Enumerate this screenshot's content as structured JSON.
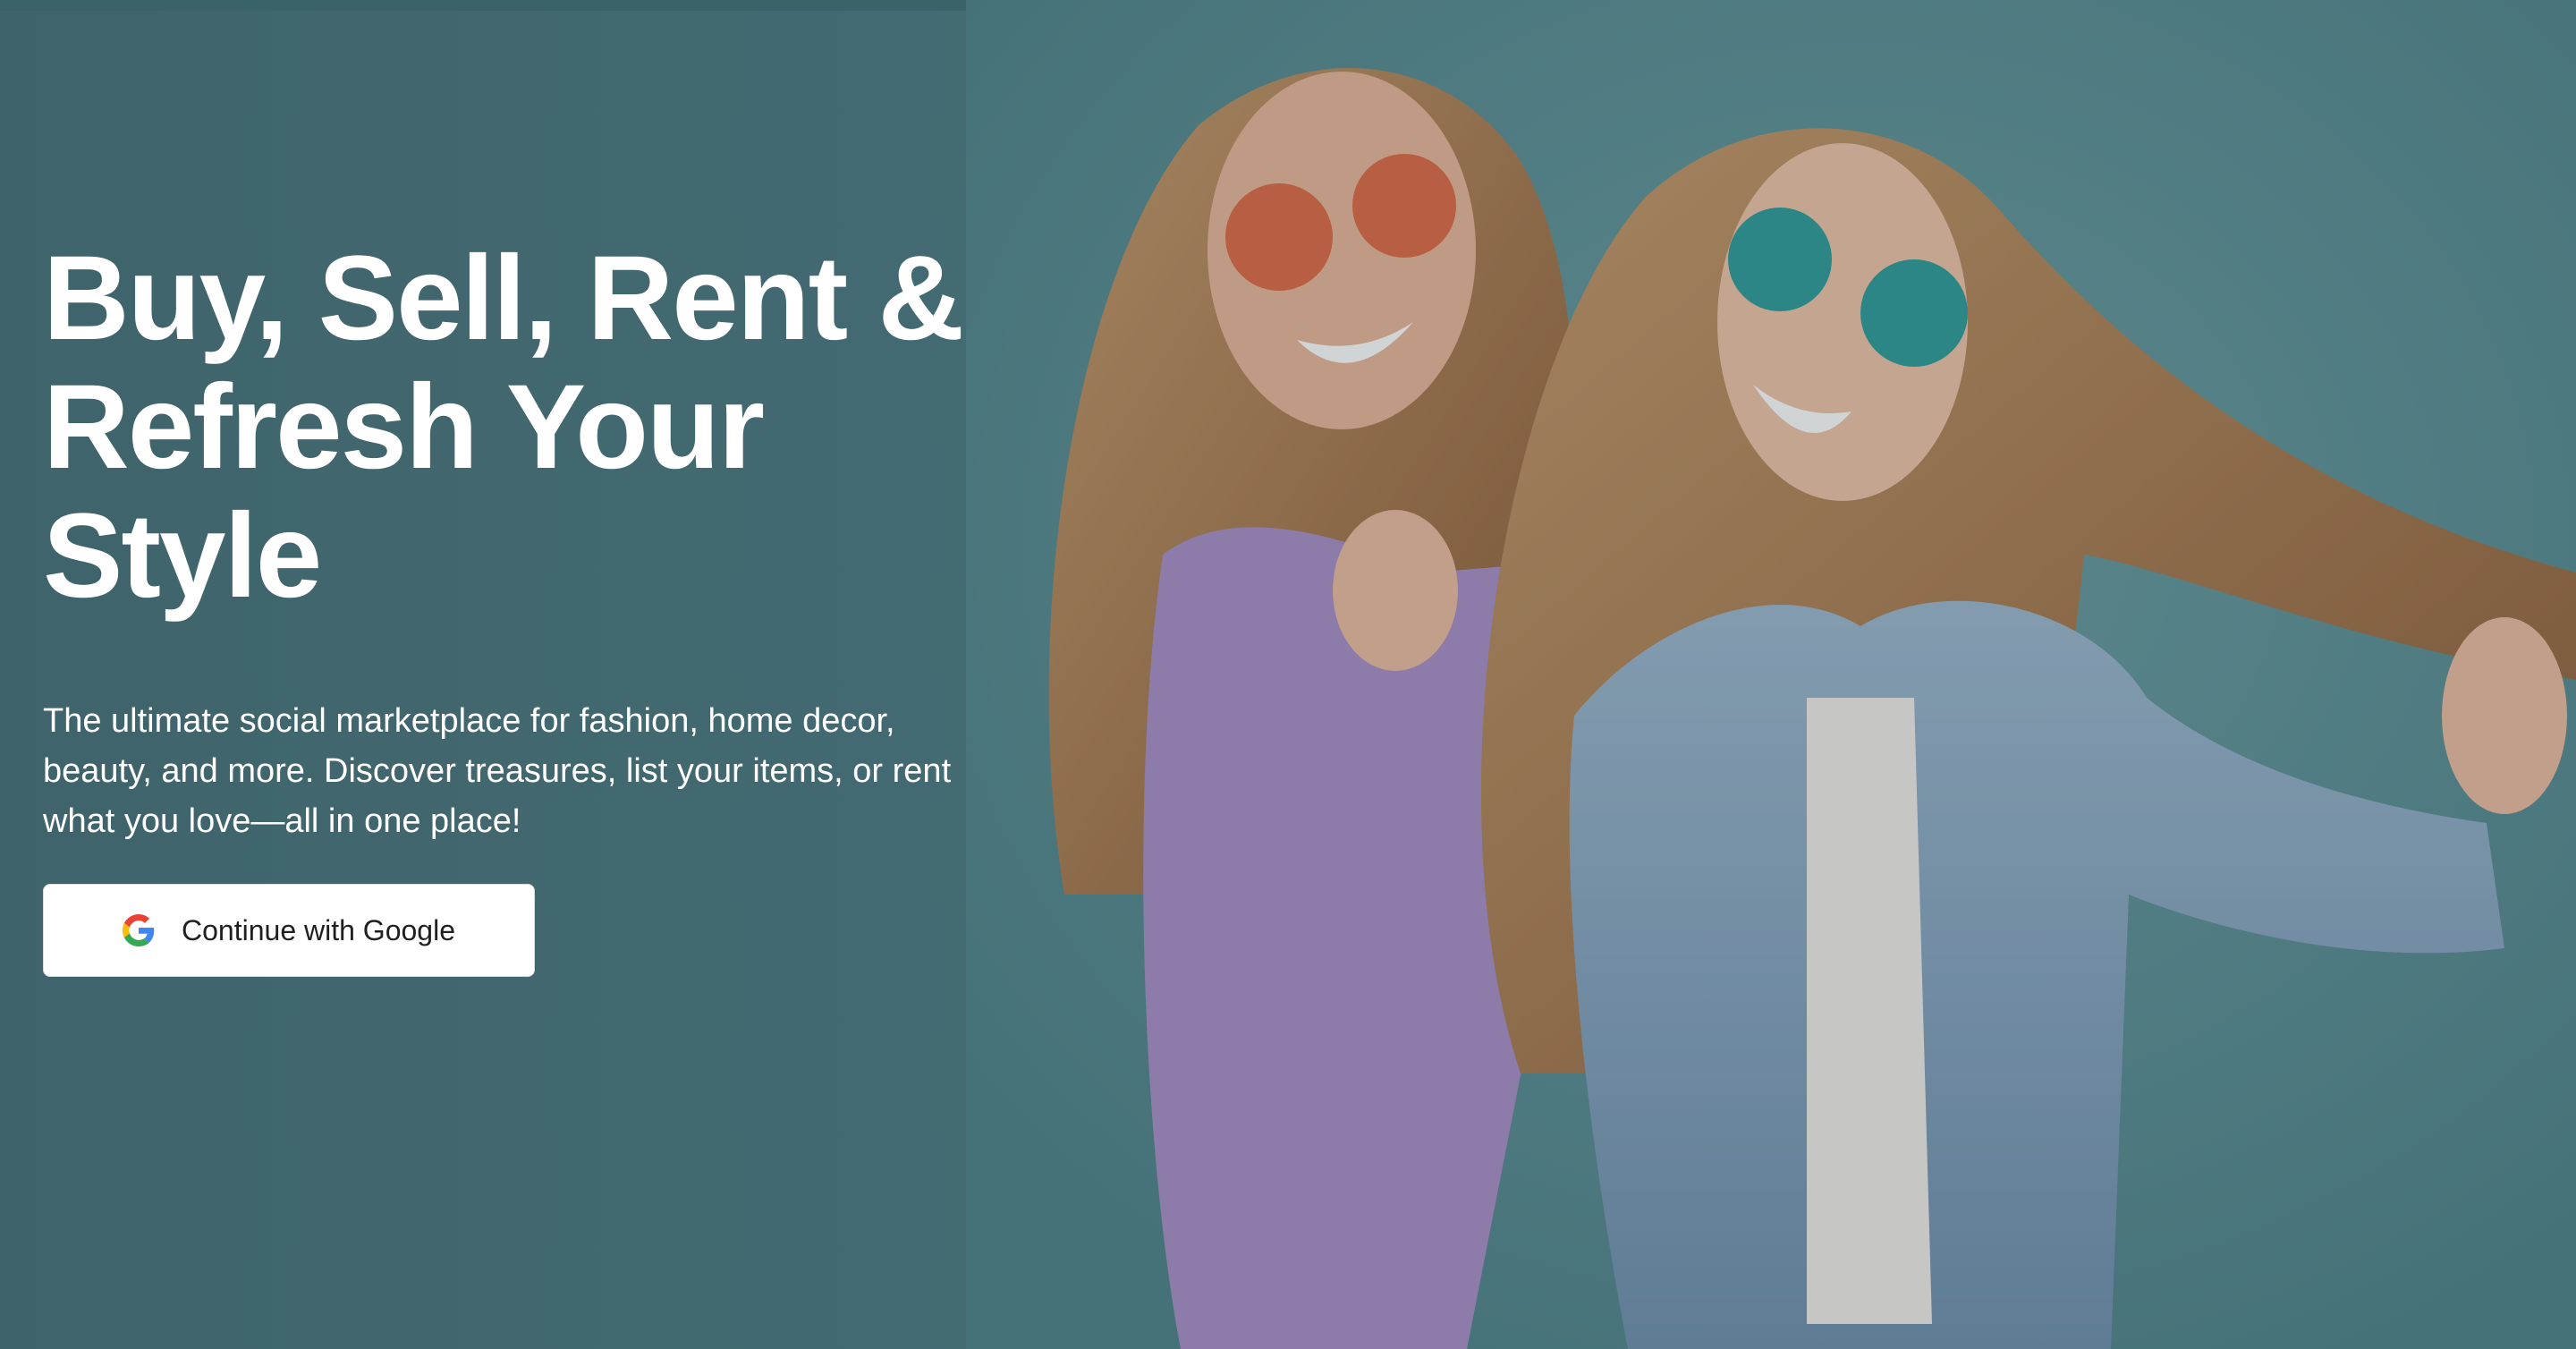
{
  "hero": {
    "headline_lines": [
      "Buy, Sell, Rent &",
      "Refresh Your",
      "Style"
    ],
    "subtitle_lines": [
      "The ultimate social marketplace for fashion, home decor,",
      "beauty, and more. Discover treasures, list your items, or rent",
      "what you love—all in one place!"
    ],
    "cta_label": "Continue with Google",
    "cta_icon": "google-icon",
    "image_subject": "hero-photo"
  },
  "colors": {
    "background": "#4b7880",
    "text": "#ffffff",
    "button_background": "#ffffff",
    "button_text": "#1f1f1f"
  }
}
